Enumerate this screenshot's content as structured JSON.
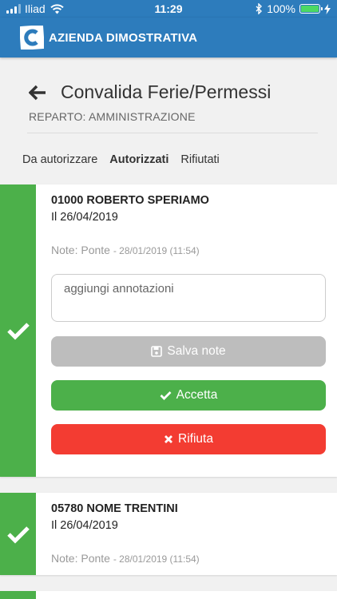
{
  "status_bar": {
    "carrier": "Iliad",
    "time": "11:29",
    "battery": "100%"
  },
  "header": {
    "app_title": "AZIENDA DIMOSTRATIVA"
  },
  "page": {
    "title": "Convalida Ferie/Permessi",
    "department": "REPARTO: AMMINISTRAZIONE"
  },
  "tabs": [
    {
      "label": "Da autorizzare",
      "active": false
    },
    {
      "label": "Autorizzati",
      "active": true
    },
    {
      "label": "Rifiutati",
      "active": false
    }
  ],
  "requests": [
    {
      "employee": "01000 ROBERTO SPERIAMO",
      "date": "Il 26/04/2019",
      "note_label": "Note: Ponte",
      "note_meta": "- 28/01/2019 (11:54)",
      "annotation_placeholder": "aggiungi annotazioni",
      "save_label": "Salva note",
      "accept_label": "Accetta",
      "reject_label": "Rifiuta"
    },
    {
      "employee": "05780 NOME TRENTINI",
      "date": "Il 26/04/2019",
      "note_label": "Note: Ponte",
      "note_meta": "- 28/01/2019 (11:54)"
    }
  ],
  "colors": {
    "header": "#2d7cbc",
    "approved": "#4cb04a",
    "reject": "#f33c32",
    "disabled": "#bdbdbd"
  },
  "icons": [
    "signal-icon",
    "wifi-icon",
    "bluetooth-icon",
    "battery-icon",
    "logo-icon",
    "back-arrow-icon",
    "check-icon",
    "save-icon",
    "reject-x-icon"
  ]
}
